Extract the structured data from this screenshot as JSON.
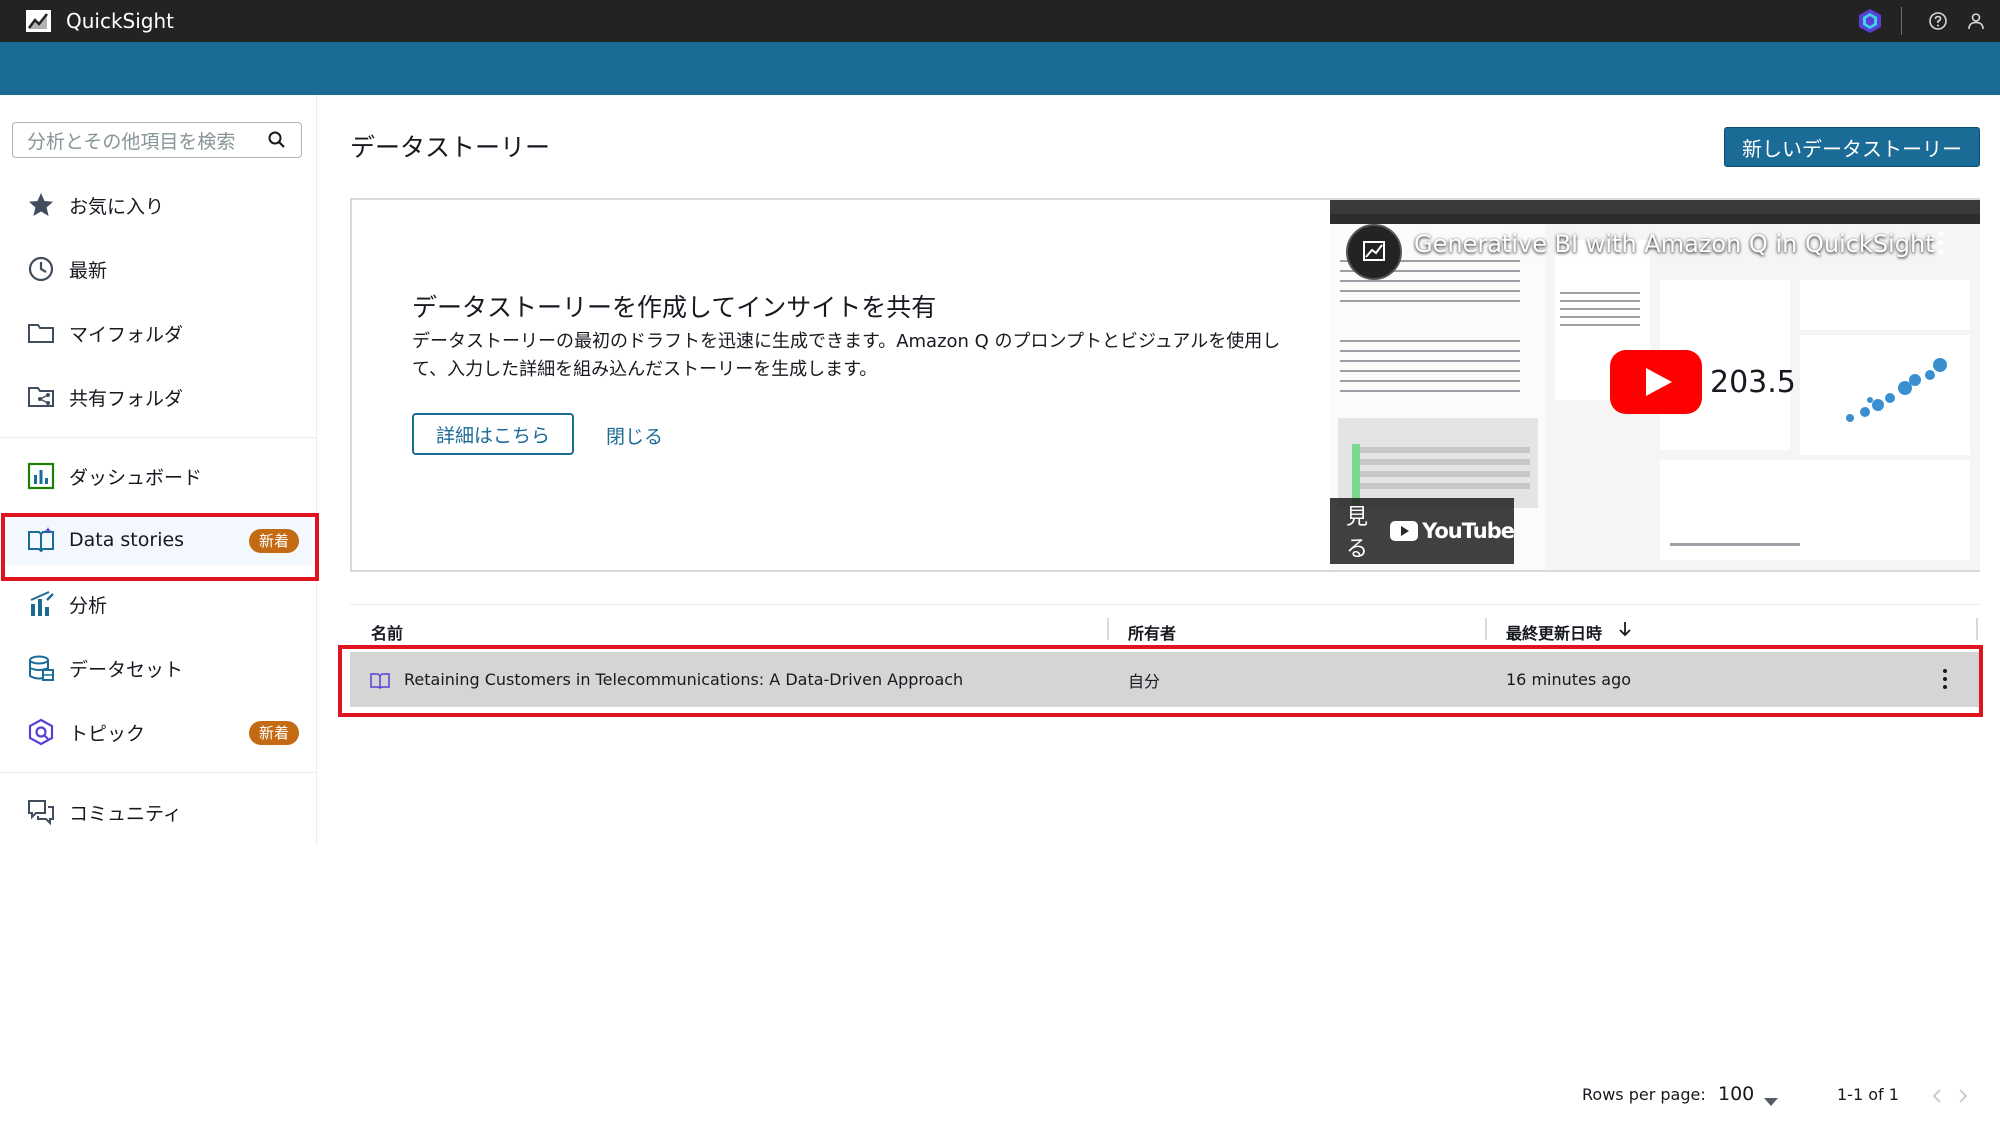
{
  "app": {
    "title": "QuickSight"
  },
  "sidebar": {
    "search_placeholder": "分析とその他項目を検索",
    "items": [
      {
        "label": "お気に入り",
        "icon": "star-icon"
      },
      {
        "label": "最新",
        "icon": "clock-icon"
      },
      {
        "label": "マイフォルダ",
        "icon": "folder-icon"
      },
      {
        "label": "共有フォルダ",
        "icon": "shared-folder-icon"
      },
      {
        "label": "ダッシュボード",
        "icon": "dashboard-icon"
      },
      {
        "label": "Data stories",
        "icon": "data-stories-icon",
        "badge": "新着",
        "selected": true
      },
      {
        "label": "分析",
        "icon": "analysis-icon"
      },
      {
        "label": "データセット",
        "icon": "dataset-icon"
      },
      {
        "label": "トピック",
        "icon": "topic-icon",
        "badge": "新着"
      },
      {
        "label": "コミュニティ",
        "icon": "community-icon"
      }
    ]
  },
  "main": {
    "title": "データストーリー",
    "new_button": "新しいデータストーリー",
    "promo": {
      "heading": "データストーリーを作成してインサイトを共有",
      "description": "データストーリーの最初のドラフトを迅速に生成できます。Amazon Q のプロンプトとビジュアルを使用して、入力した詳細を組み込んだストーリーを生成します。",
      "learn_more": "詳細はこちら",
      "close": "閉じる",
      "video": {
        "title": "Generative BI with Amazon Q in QuickSight",
        "watch": "見る",
        "provider": "YouTube",
        "highlight_value": "203.5"
      }
    },
    "table": {
      "columns": [
        "名前",
        "所有者",
        "最終更新日時"
      ],
      "sort_column": "最終更新日時",
      "rows": [
        {
          "name": "Retaining Customers in Telecommunications: A Data-Driven Approach",
          "owner": "自分",
          "updated": "16 minutes ago"
        }
      ]
    },
    "pagination": {
      "rows_per_page_label": "Rows per page:",
      "rows_per_page": "100",
      "range": "1-1 of 1"
    }
  },
  "colors": {
    "top_bar": "#232323",
    "brand_band": "#1b6b97",
    "badge": "#c46a12",
    "highlight": "#e0141e",
    "selected_row": "#d5d5d5"
  }
}
